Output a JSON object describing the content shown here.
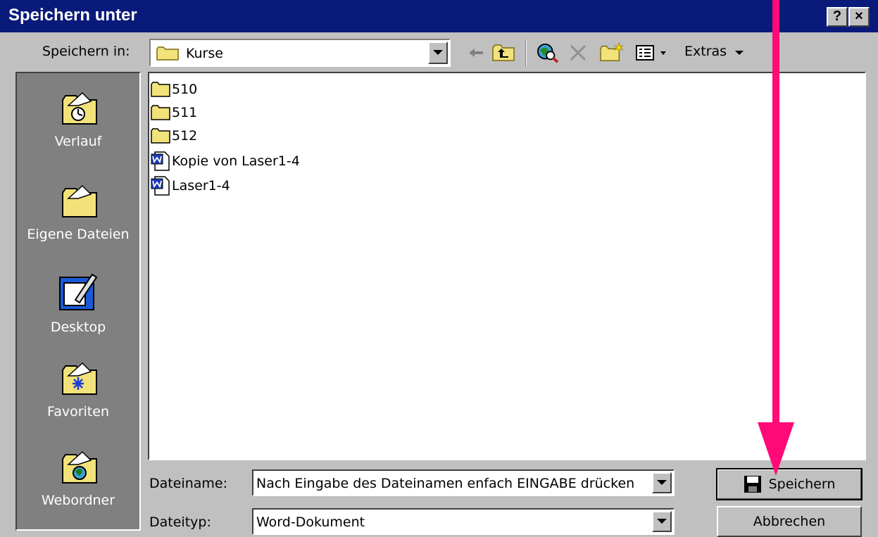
{
  "dialog": {
    "title": "Speichern unter",
    "help_button": "?",
    "close_button": "×"
  },
  "toolbar": {
    "save_in_label": "Speichern in:",
    "location": "Kurse",
    "extras_label": "Extras",
    "icons": [
      "back-icon",
      "up-folder-icon",
      "search-web-icon",
      "delete-icon",
      "new-folder-icon",
      "views-icon"
    ]
  },
  "places": [
    {
      "label": "Verlauf",
      "icon": "history-icon"
    },
    {
      "label": "Eigene Dateien",
      "icon": "my-documents-icon"
    },
    {
      "label": "Desktop",
      "icon": "desktop-icon"
    },
    {
      "label": "Favoriten",
      "icon": "favorites-icon"
    },
    {
      "label": "Webordner",
      "icon": "web-folders-icon"
    }
  ],
  "files": [
    {
      "name": "510",
      "type": "folder"
    },
    {
      "name": "511",
      "type": "folder"
    },
    {
      "name": "512",
      "type": "folder"
    },
    {
      "name": "Kopie von Laser1-4",
      "type": "word"
    },
    {
      "name": "Laser1-4",
      "type": "word"
    }
  ],
  "form": {
    "filename_label": "Dateiname:",
    "filename_value": "Nach Eingabe des Dateinamen enfach EINGABE drücken",
    "filetype_label": "Dateityp:",
    "filetype_value": "Word-Dokument",
    "save_button": "Speichern",
    "cancel_button": "Abbrechen"
  },
  "colors": {
    "title_bar": "#0a1a7a",
    "dialog_face": "#c0c0c0",
    "places_bar": "#808080",
    "folder": "#f2e27a",
    "annotation_arrow": "#ff0a78"
  }
}
